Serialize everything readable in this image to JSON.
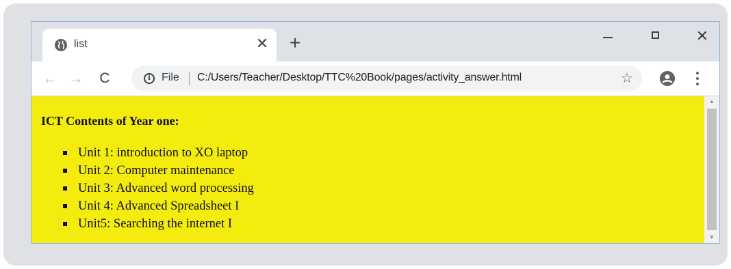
{
  "browser": {
    "tab": {
      "title": "list",
      "close_glyph": "✕",
      "favicon": "globe-icon"
    },
    "new_tab_glyph": "+",
    "window_controls": {
      "close_glyph": "✕"
    },
    "nav": {
      "back_glyph": "←",
      "forward_glyph": "→",
      "reload_glyph": "C"
    },
    "omnibox": {
      "info_glyph": "i",
      "scheme_label": "File",
      "url": "C:/Users/Teacher/Desktop/TTC%20Book/pages/activity_answer.html",
      "bookmark_glyph": "☆"
    }
  },
  "page": {
    "background": "#f3ec0e",
    "heading": "ICT Contents of Year one:",
    "items": [
      "Unit 1: introduction to XO laptop",
      "Unit 2: Computer maintenance",
      "Unit 3: Advanced word processing",
      "Unit 4: Advanced Spreadsheet I",
      "Unit5: Searching the internet I"
    ]
  },
  "scrollbar": {
    "up_glyph": "▲",
    "down_glyph": "▼"
  }
}
